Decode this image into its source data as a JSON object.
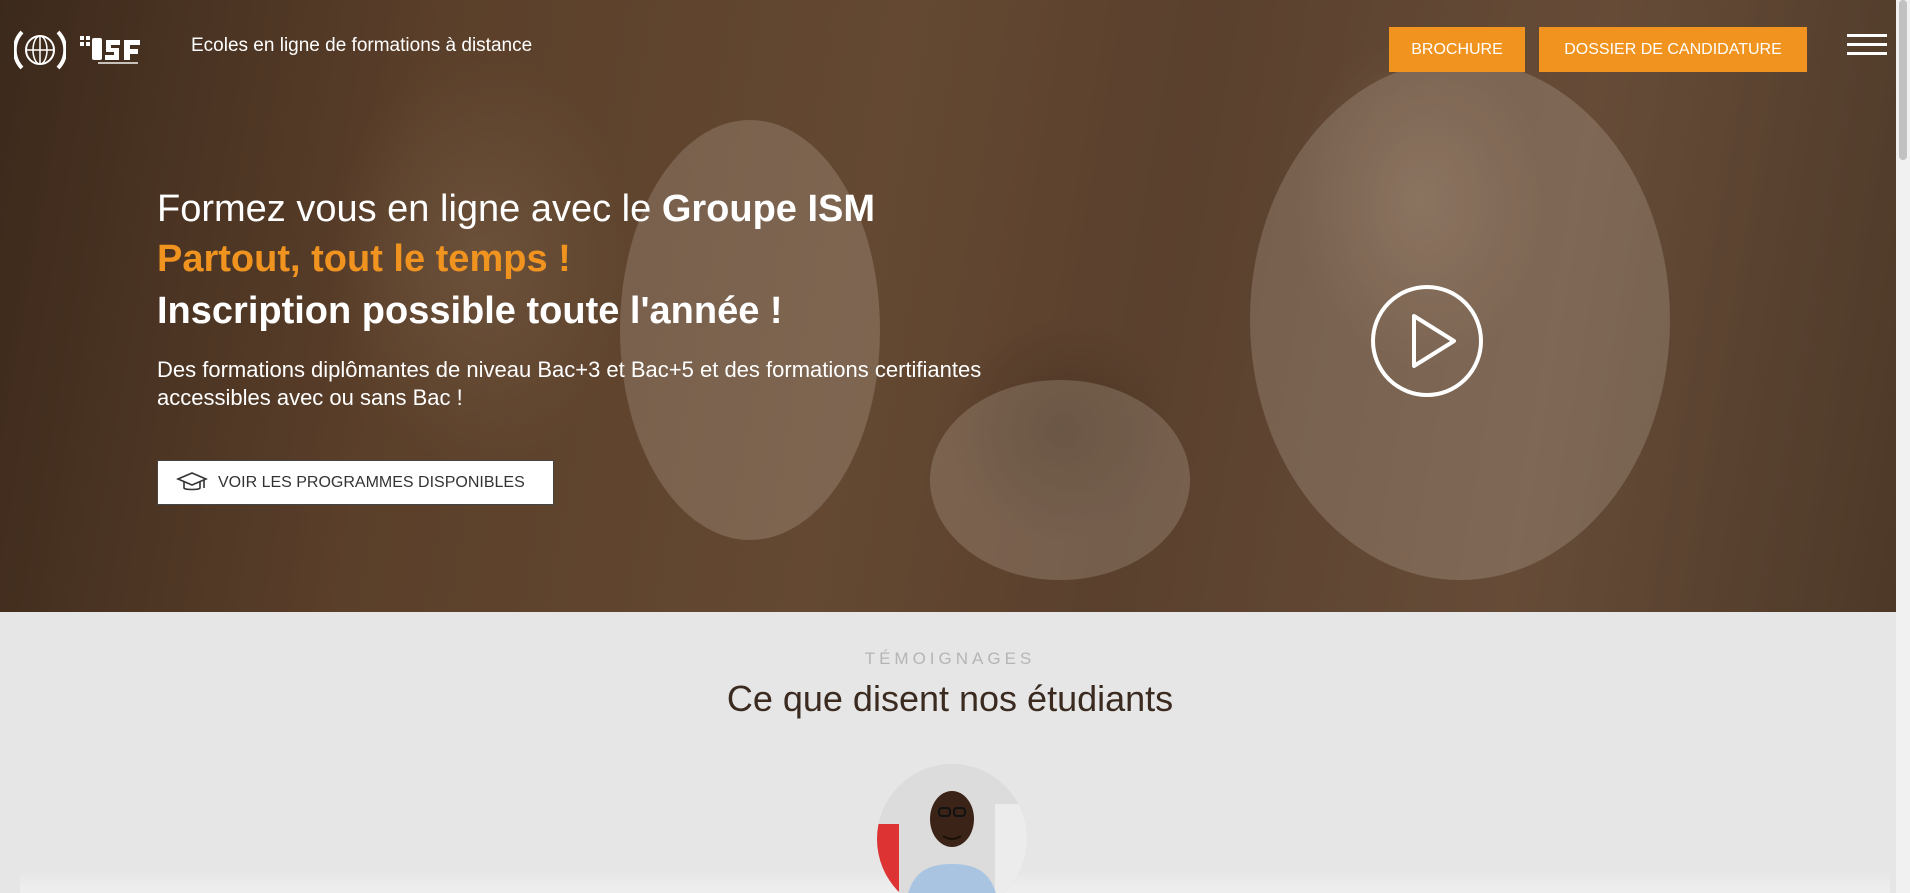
{
  "header": {
    "tagline": "Ecoles en ligne de formations à distance",
    "brochure_label": "BROCHURE",
    "dossier_label": "DOSSIER DE CANDIDATURE"
  },
  "hero": {
    "title_prefix": "Formez vous en ligne avec le ",
    "title_brand": "Groupe ISM",
    "subtitle": "Partout, tout le temps !",
    "headline": "Inscription possible toute l'année !",
    "description": "Des formations diplômantes de niveau Bac+3 et Bac+5 et des formations certifiantes accessibles avec ou sans Bac !",
    "cta_label": "VOIR LES PROGRAMMES DISPONIBLES"
  },
  "testimonials": {
    "eyebrow": "TÉMOIGNAGES",
    "title": "Ce que disent nos étudiants"
  },
  "colors": {
    "accent": "#f0931f",
    "hero_overlay": "#6b4c33",
    "section_bg": "#e6e6e6"
  },
  "icons": [
    "ism-logo-icon",
    "isf-logo-icon",
    "hamburger-menu-icon",
    "play-icon",
    "graduation-cap-icon"
  ]
}
